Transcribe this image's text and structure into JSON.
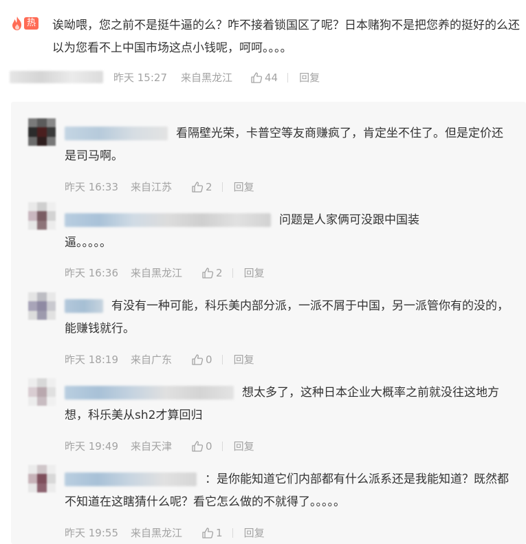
{
  "main": {
    "hot_label": "热",
    "text": "诶呦喂，您之前不是挺牛逼的么？咋不接着锁国区了呢？日本赌狗不是把您养的挺好的么还以为您看不上中国市场这点小钱呢，呵呵。。。。",
    "time": "昨天 15:27",
    "location": "来自黑龙江",
    "likes": "44",
    "reply_label": "回复"
  },
  "replies": [
    {
      "text": "看隔壁光荣，卡普空等友商赚疯了，肯定坐不住了。但是定价还是司马啊。",
      "time": "昨天 16:33",
      "location": "来自江苏",
      "likes": "2",
      "reply_label": "回复"
    },
    {
      "text": "问题是人家俩可没跟中国装逼。。。。。",
      "time": "昨天 16:36",
      "location": "来自黑龙江",
      "likes": "2",
      "reply_label": "回复"
    },
    {
      "text": "有没有一种可能，科乐美内部分派，一派不屑于中国，另一派管你有的没的，能赚钱就行。",
      "time": "昨天 18:19",
      "location": "来自广东",
      "likes": "0",
      "reply_label": "回复"
    },
    {
      "text": "想太多了，这种日本企业大概率之前就没往这地方想，科乐美从sh2才算回归",
      "time": "昨天 19:49",
      "location": "来自天津",
      "likes": "0",
      "reply_label": "回复"
    },
    {
      "text": "：是你能知道它们内部都有什么派系还是我能知道？既然都不知道在这瞎猜什么呢？看它怎么做的不就得了。。。。。",
      "time": "昨天 19:55",
      "location": "来自黑龙江",
      "likes": "1",
      "reply_label": "回复"
    }
  ],
  "icons": {
    "hot": "flame-icon",
    "like": "thumb-up-icon"
  },
  "colors": {
    "hot_badge": "#ff6b55",
    "meta_text": "#a3a3a3",
    "body_text": "#333333",
    "reply_panel": "#f7f7f7"
  }
}
